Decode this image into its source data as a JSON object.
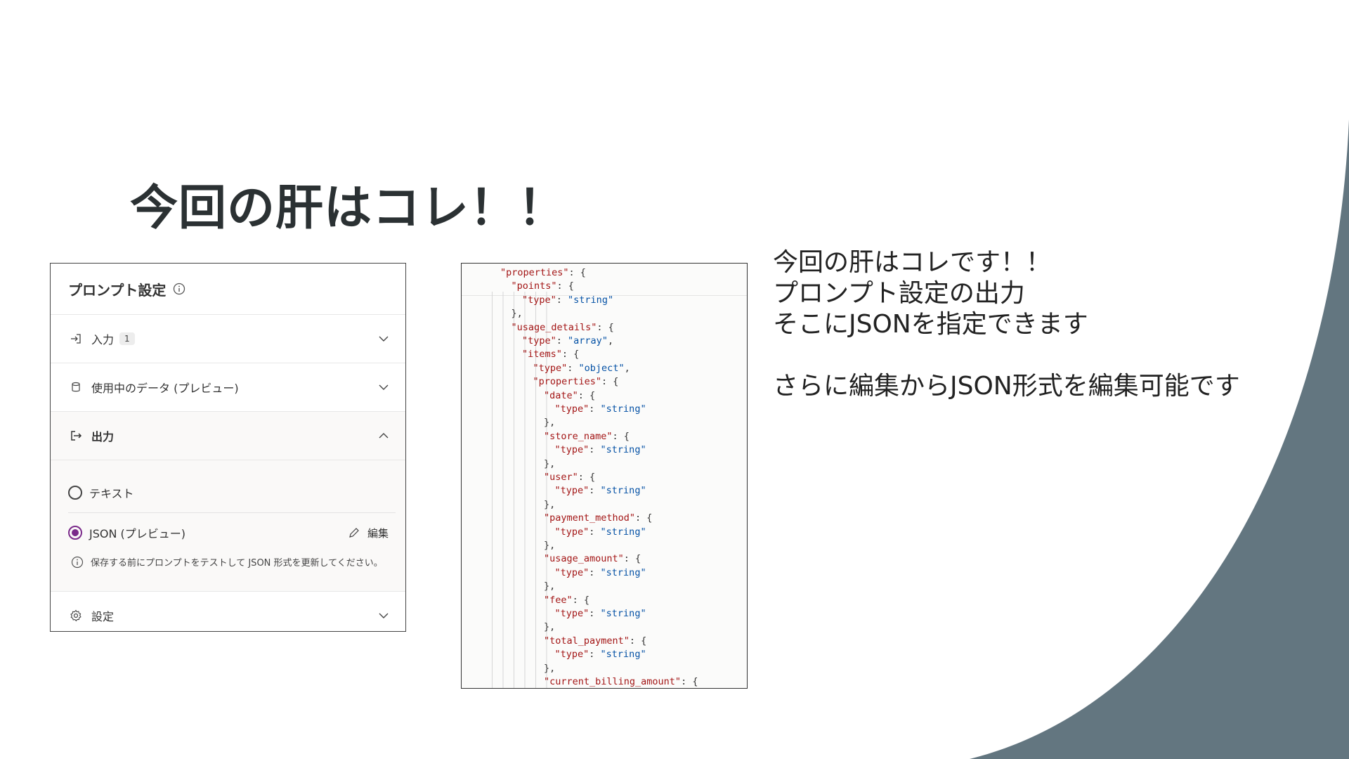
{
  "slide": {
    "title": "今回の肝はコレ！！",
    "accent_color": "#637680"
  },
  "prompt_panel": {
    "title": "プロンプト設定",
    "sections": [
      {
        "label": "入力",
        "badge": "1",
        "icon": "input-arrow-icon",
        "expanded": false
      },
      {
        "label": "使用中のデータ (プレビュー)",
        "icon": "database-icon",
        "expanded": false
      },
      {
        "label": "出力",
        "icon": "output-arrow-icon",
        "expanded": true
      },
      {
        "label": "設定",
        "icon": "gear-icon",
        "expanded": false
      }
    ],
    "output": {
      "options": [
        {
          "label": "テキスト",
          "selected": false
        },
        {
          "label": "JSON (プレビュー)",
          "selected": true
        }
      ],
      "edit_label": "編集",
      "note": "保存する前にプロンプトをテストして JSON 形式を更新してください。",
      "selected_color": "#7a2a8a"
    }
  },
  "code_panel": {
    "lines": [
      {
        "indent": 2,
        "key": "\"properties\"",
        "rest": ": {"
      },
      {
        "indent": 3,
        "key": "\"points\"",
        "rest": ": {"
      },
      {
        "indent": 4,
        "key": "\"type\"",
        "rest": ": ",
        "str": "\"string\""
      },
      {
        "indent": 3,
        "key": "",
        "rest": "},"
      },
      {
        "indent": 3,
        "key": "\"usage_details\"",
        "rest": ": {"
      },
      {
        "indent": 4,
        "key": "\"type\"",
        "rest": ": ",
        "str": "\"array\"",
        "tail": ","
      },
      {
        "indent": 4,
        "key": "\"items\"",
        "rest": ": {"
      },
      {
        "indent": 5,
        "key": "\"type\"",
        "rest": ": ",
        "str": "\"object\"",
        "tail": ","
      },
      {
        "indent": 5,
        "key": "\"properties\"",
        "rest": ": {"
      },
      {
        "indent": 6,
        "key": "\"date\"",
        "rest": ": {"
      },
      {
        "indent": 7,
        "key": "\"type\"",
        "rest": ": ",
        "str": "\"string\""
      },
      {
        "indent": 6,
        "key": "",
        "rest": "},"
      },
      {
        "indent": 6,
        "key": "\"store_name\"",
        "rest": ": {"
      },
      {
        "indent": 7,
        "key": "\"type\"",
        "rest": ": ",
        "str": "\"string\""
      },
      {
        "indent": 6,
        "key": "",
        "rest": "},"
      },
      {
        "indent": 6,
        "key": "\"user\"",
        "rest": ": {"
      },
      {
        "indent": 7,
        "key": "\"type\"",
        "rest": ": ",
        "str": "\"string\""
      },
      {
        "indent": 6,
        "key": "",
        "rest": "},"
      },
      {
        "indent": 6,
        "key": "\"payment_method\"",
        "rest": ": {"
      },
      {
        "indent": 7,
        "key": "\"type\"",
        "rest": ": ",
        "str": "\"string\""
      },
      {
        "indent": 6,
        "key": "",
        "rest": "},"
      },
      {
        "indent": 6,
        "key": "\"usage_amount\"",
        "rest": ": {"
      },
      {
        "indent": 7,
        "key": "\"type\"",
        "rest": ": ",
        "str": "\"string\""
      },
      {
        "indent": 6,
        "key": "",
        "rest": "},"
      },
      {
        "indent": 6,
        "key": "\"fee\"",
        "rest": ": {"
      },
      {
        "indent": 7,
        "key": "\"type\"",
        "rest": ": ",
        "str": "\"string\""
      },
      {
        "indent": 6,
        "key": "",
        "rest": "},"
      },
      {
        "indent": 6,
        "key": "\"total_payment\"",
        "rest": ": {"
      },
      {
        "indent": 7,
        "key": "\"type\"",
        "rest": ": ",
        "str": "\"string\""
      },
      {
        "indent": 6,
        "key": "",
        "rest": "},"
      },
      {
        "indent": 6,
        "key": "\"current_billing_amount\"",
        "rest": ": {"
      }
    ]
  },
  "description": {
    "lines": [
      "今回の肝はコレです！！",
      "プロンプト設定の出力",
      "そこにJSONを指定できます",
      "",
      "さらに編集からJSON形式を編集可能です"
    ]
  }
}
